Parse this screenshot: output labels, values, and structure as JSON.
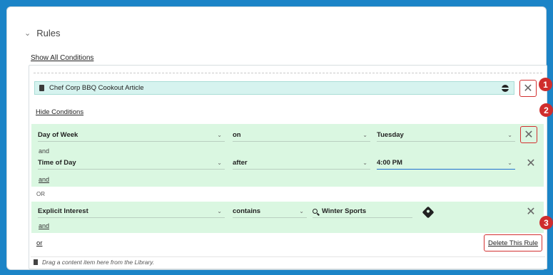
{
  "rules": {
    "section_label": "Rules",
    "show_all_conditions": "Show All Conditions",
    "hide_conditions": "Hide Conditions",
    "content_item": {
      "title": "Chef Corp BBQ Cookout Article"
    },
    "groups": [
      {
        "rows": [
          {
            "field": "Day of Week",
            "operator": "on",
            "value": "Tuesday",
            "joiner": "and"
          },
          {
            "field": "Time of Day",
            "operator": "after",
            "value": "4:00 PM"
          }
        ],
        "and_link": "and"
      },
      {
        "rows": [
          {
            "field": "Explicit Interest",
            "operator": "contains",
            "value": "Winter Sports"
          }
        ],
        "and_link": "and"
      }
    ],
    "or_separator": "OR",
    "or_link": "or",
    "delete_rule": "Delete This Rule",
    "drag_hint": "Drag a content item here from the Library."
  },
  "callouts": [
    "1",
    "2",
    "3"
  ],
  "colors": {
    "accent": "#1b84c7",
    "condition_bg": "#daf7e1",
    "item_bg": "#d6f3ef",
    "callout": "#cf2d2d",
    "focus": "#1f6fd0"
  },
  "icons": [
    "chevron-down-icon",
    "content-item-icon",
    "globe-icon",
    "close-icon",
    "search-icon",
    "interest-icon",
    "document-icon"
  ]
}
